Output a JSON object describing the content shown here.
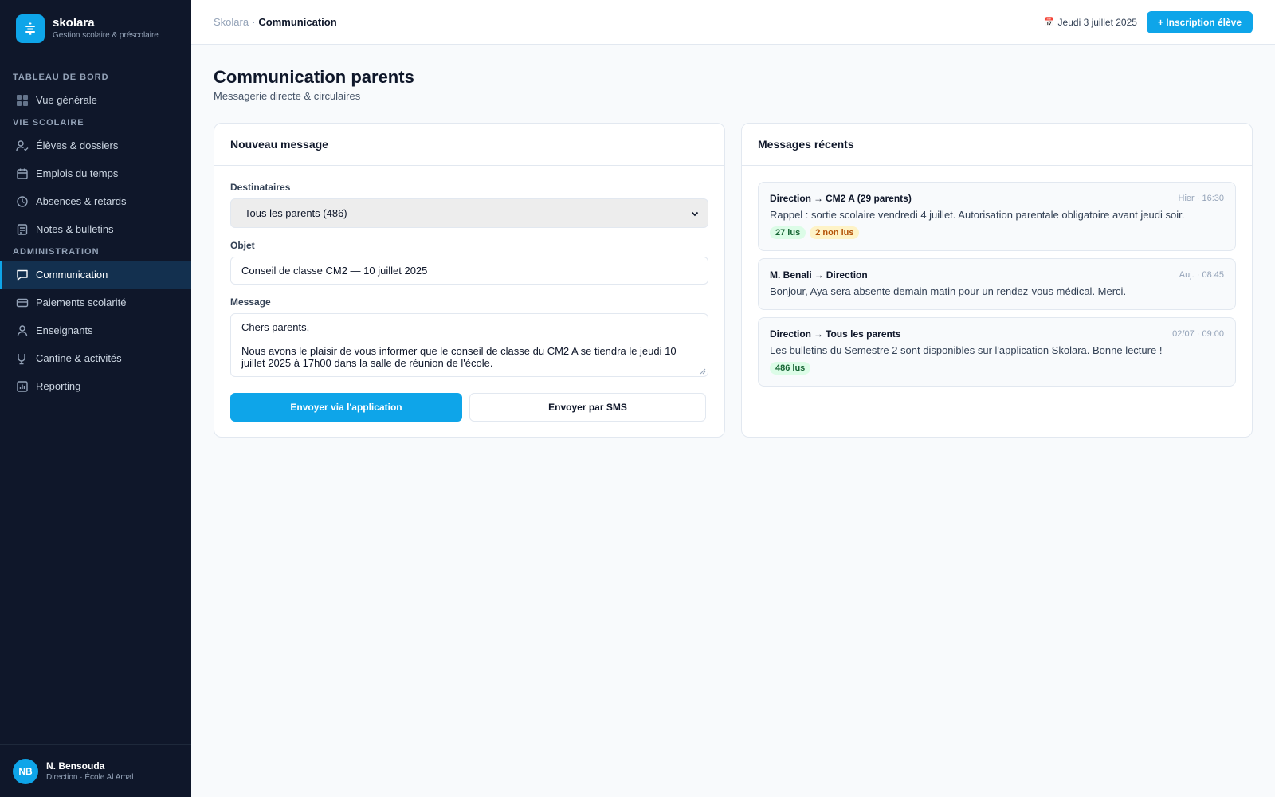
{
  "brand": {
    "name": "skolara",
    "subtitle": "Gestion scolaire & préscolaire"
  },
  "sidebar": {
    "sections": [
      {
        "label": "TABLEAU DE BORD",
        "items": [
          {
            "label": "Vue générale",
            "icon": "grid-icon"
          }
        ]
      },
      {
        "label": "VIE SCOLAIRE",
        "items": [
          {
            "label": "Élèves & dossiers",
            "icon": "user-check-icon"
          },
          {
            "label": "Emplois du temps",
            "icon": "calendar-icon"
          },
          {
            "label": "Absences & retards",
            "icon": "clock-icon"
          },
          {
            "label": "Notes & bulletins",
            "icon": "document-icon"
          }
        ]
      },
      {
        "label": "ADMINISTRATION",
        "items": [
          {
            "label": "Communication",
            "icon": "message-icon",
            "active": true
          },
          {
            "label": "Paiements scolarité",
            "icon": "credit-card-icon"
          },
          {
            "label": "Enseignants",
            "icon": "user-icon"
          },
          {
            "label": "Cantine & activités",
            "icon": "cup-icon"
          },
          {
            "label": "Reporting",
            "icon": "chart-icon"
          }
        ]
      }
    ]
  },
  "user": {
    "initials": "NB",
    "name": "N. Bensouda",
    "role": "Direction · École Al Amal"
  },
  "topbar": {
    "breadcrumb": {
      "root": "Skolara",
      "separator": "·",
      "current": "Communication"
    },
    "date": "Jeudi 3 juillet 2025",
    "date_icon": "calendar-emoji-icon",
    "primary_button": "+ Inscription élève"
  },
  "page": {
    "title": "Communication parents",
    "subtitle": "Messagerie directe & circulaires"
  },
  "compose": {
    "title": "Nouveau message",
    "recipients_label": "Destinataires",
    "recipients_value": "Tous les parents (486)",
    "subject_label": "Objet",
    "subject_value": "Conseil de classe CM2 — 10 juillet 2025",
    "message_label": "Message",
    "message_line1": "Chers parents,",
    "message_line2": "Nous avons le plaisir de vous informer que le conseil de classe du CM2 A se tiendra le jeudi 10 juillet 2025 à 17h00 dans la salle de réunion de l'école.",
    "send_app_label": "Envoyer via l'application",
    "send_sms_label": "Envoyer par SMS"
  },
  "recent": {
    "title": "Messages récents",
    "messages": [
      {
        "from": "Direction",
        "arrow": "→",
        "to": "CM2 A (29 parents)",
        "time": "Hier · 16:30",
        "text": "Rappel : sortie scolaire vendredi 4 juillet. Autorisation parentale obligatoire avant jeudi soir.",
        "badges": [
          {
            "label": "27 lus",
            "color": "#dcfce7"
          },
          {
            "label": "2 non lus",
            "color": "#fef3c7"
          }
        ]
      },
      {
        "from": "M. Benali",
        "arrow": "→",
        "to": "Direction",
        "time": "Auj. · 08:45",
        "text": "Bonjour, Aya sera absente demain matin pour un rendez-vous médical. Merci.",
        "badges": []
      },
      {
        "from": "Direction",
        "arrow": "→",
        "to": "Tous les parents",
        "time": "02/07 · 09:00",
        "text": "Les bulletins du Semestre 2 sont disponibles sur l'application Skolara. Bonne lecture !",
        "badges": [
          {
            "label": "486 lus",
            "color": "#dcfce7"
          }
        ]
      }
    ]
  },
  "colors": {
    "sidebar_bg": "#0f172a",
    "accent": "#0ea5e9",
    "active_item_bg": "#13304f",
    "page_bg": "#f8fafc"
  }
}
